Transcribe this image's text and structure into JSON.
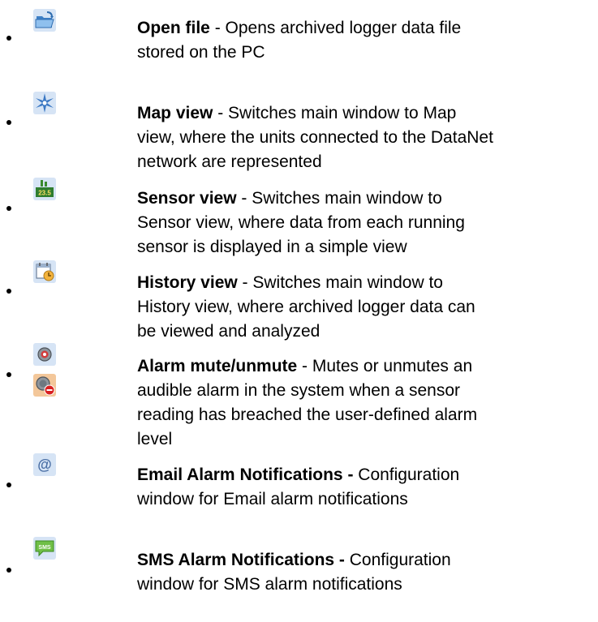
{
  "items": [
    {
      "icon": "open-folder-icon",
      "title": "Open file",
      "line1": " - Opens archived logger data file",
      "line2": "stored on the PC",
      "line3": "",
      "line4": ""
    },
    {
      "icon": "map-star-icon",
      "title": "Map view",
      "line1": " - Switches main window to Map",
      "line2": "view, where the units connected to the DataNet",
      "line3": "network are represented",
      "line4": ""
    },
    {
      "icon": "sensor-reading-icon",
      "icon_text": "23.5",
      "title": "Sensor view",
      "line1": " - Switches main window to",
      "line2": "Sensor view, where data from each running",
      "line3": "sensor is displayed in a simple view",
      "line4": ""
    },
    {
      "icon": "calendar-clock-icon",
      "title": "History view",
      "line1": " - Switches main window to",
      "line2": "History view, where archived logger data can",
      "line3": "be viewed and analyzed",
      "line4": ""
    },
    {
      "icon": "alarm-icon",
      "icon2": "alarm-muted-icon",
      "title": "Alarm mute/unmute",
      "line1": " - Mutes or unmutes an",
      "line2": "audible alarm in the system when a sensor",
      "line3": "reading has breached the user-defined alarm",
      "line4": "level"
    },
    {
      "icon": "email-at-icon",
      "title": "Email Alarm Notifications -",
      "line1": " Configuration",
      "line2": "window for Email alarm notifications",
      "line3": "",
      "line4": ""
    },
    {
      "icon": "sms-bubble-icon",
      "icon_text": "SMS",
      "title": "SMS Alarm Notifications -",
      "line1": " Configuration",
      "line2": "window for SMS alarm notifications",
      "line3": "",
      "line4": ""
    }
  ]
}
